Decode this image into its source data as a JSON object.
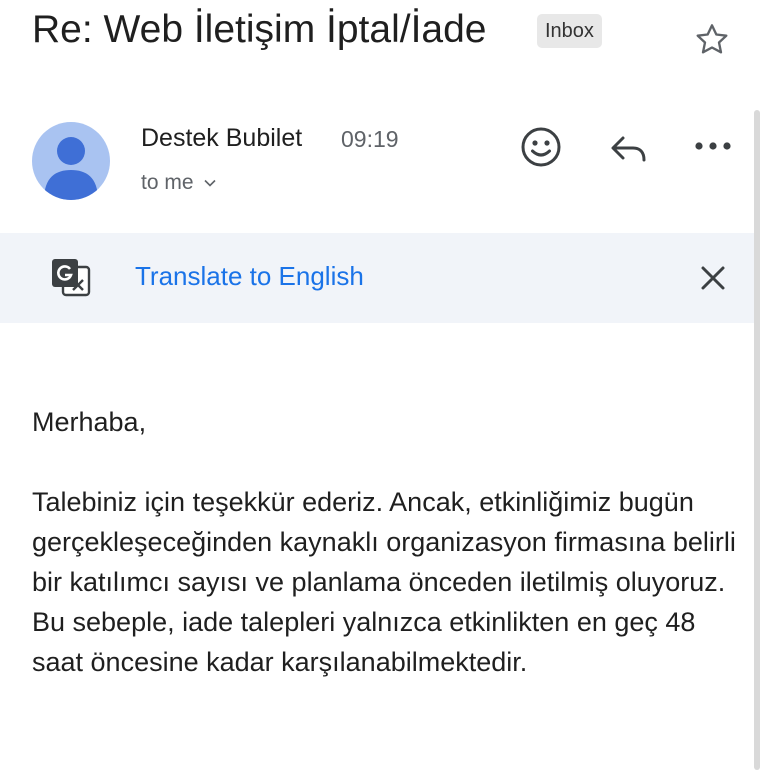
{
  "email": {
    "subject": "Re: Web İletişim İptal/İade",
    "label": "Inbox",
    "sender": "Destek Bubilet",
    "time": "09:19",
    "recipient": "to me"
  },
  "translate": {
    "link": "Translate to English"
  },
  "icons": {
    "star": "star-outline-icon",
    "avatar": "person-avatar-icon",
    "emoji": "smiley-face-icon",
    "reply": "reply-arrow-icon",
    "more": "more-horizontal-icon",
    "translate": "google-translate-icon",
    "close": "close-x-icon",
    "chevron": "chevron-down-icon"
  },
  "colors": {
    "link": "#1a73e8",
    "translate_bar_bg": "#f1f4f9",
    "avatar_bg": "#a9c3f1",
    "avatar_fg": "#3f6fd6",
    "label_bg": "#e8e8e8"
  },
  "message": {
    "paragraphs": [
      "Merhaba,",
      "Talebiniz için teşekkür ederiz. Ancak, etkinliğimiz bugün gerçekleşeceğinden kaynaklı organizasyon firmasına belirli bir katılımcı sayısı ve planlama önceden iletilmiş oluyoruz. Bu sebeple, iade talepleri yalnızca etkinlikten en geç 48 saat öncesine kadar karşılanabilmektedir."
    ]
  }
}
